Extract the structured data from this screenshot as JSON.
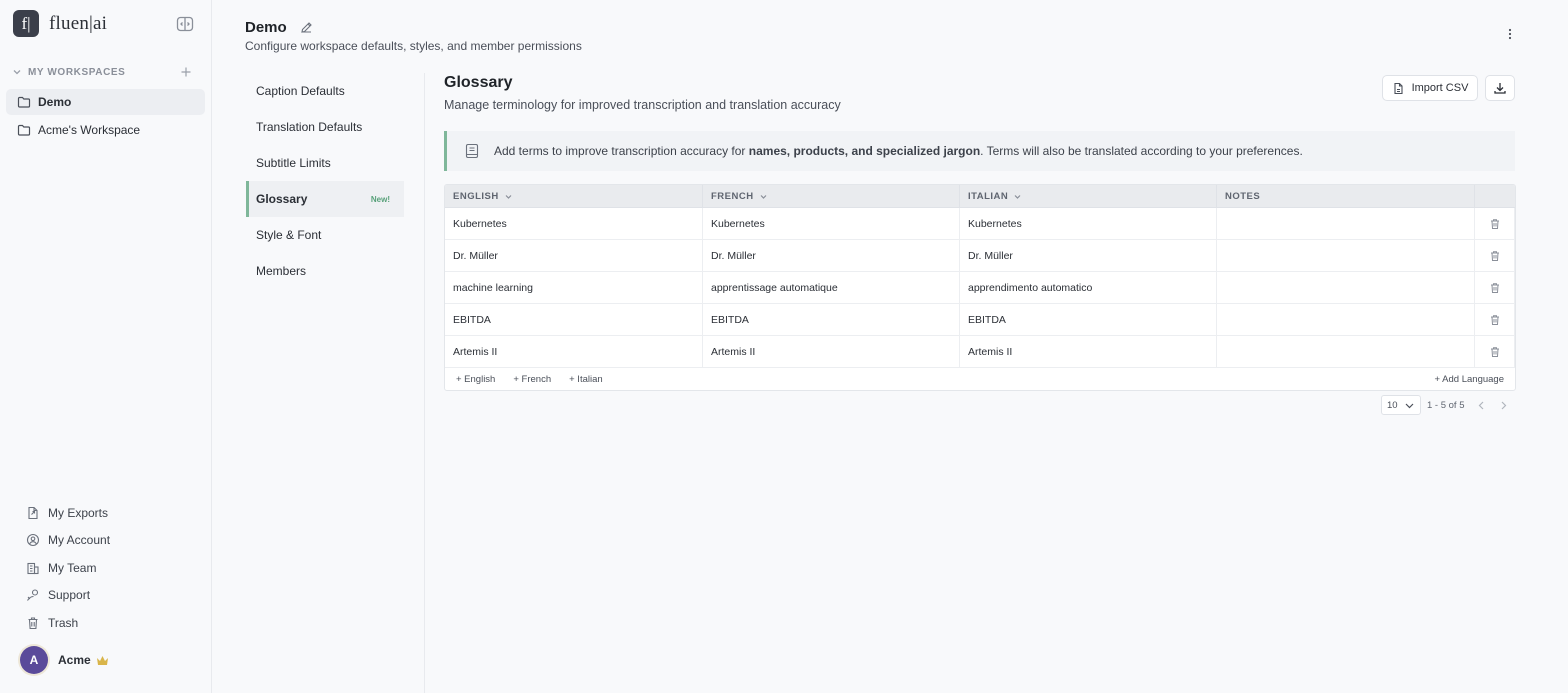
{
  "brand": {
    "logo_letter": "f|",
    "name": "fluen|ai"
  },
  "sidebar": {
    "section_label": "MY WORKSPACES",
    "workspaces": [
      {
        "label": "Demo",
        "active": true
      },
      {
        "label": "Acme's Workspace",
        "active": false
      }
    ],
    "bottom_links": [
      {
        "label": "My Exports",
        "icon": "exports-icon"
      },
      {
        "label": "My Account",
        "icon": "account-icon"
      },
      {
        "label": "My Team",
        "icon": "team-icon"
      },
      {
        "label": "Support",
        "icon": "support-icon"
      },
      {
        "label": "Trash",
        "icon": "trash-icon"
      }
    ],
    "user": {
      "initial": "A",
      "name": "Acme",
      "badge_icon": "crown-icon"
    }
  },
  "header": {
    "title": "Demo",
    "subtitle": "Configure workspace defaults, styles, and member permissions"
  },
  "settings_menu": {
    "items": [
      {
        "label": "Caption Defaults",
        "active": false,
        "badge": ""
      },
      {
        "label": "Translation Defaults",
        "active": false,
        "badge": ""
      },
      {
        "label": "Subtitle Limits",
        "active": false,
        "badge": ""
      },
      {
        "label": "Glossary",
        "active": true,
        "badge": "New!"
      },
      {
        "label": "Style & Font",
        "active": false,
        "badge": ""
      },
      {
        "label": "Members",
        "active": false,
        "badge": ""
      }
    ]
  },
  "glossary": {
    "title": "Glossary",
    "subtitle": "Manage terminology for improved transcription and translation accuracy",
    "import_label": "Import CSV",
    "info": {
      "prefix": "Add terms to improve transcription accuracy for ",
      "bold": "names, products, and specialized jargon",
      "suffix": ". Terms will also be translated according to your preferences."
    },
    "columns": [
      "ENGLISH",
      "FRENCH",
      "ITALIAN",
      "NOTES"
    ],
    "rows": [
      [
        "Kubernetes",
        "Kubernetes",
        "Kubernetes",
        ""
      ],
      [
        "Dr. Müller",
        "Dr. Müller",
        "Dr. Müller",
        ""
      ],
      [
        "machine learning",
        "apprentissage automatique",
        "apprendimento automatico",
        ""
      ],
      [
        "EBITDA",
        "EBITDA",
        "EBITDA",
        ""
      ],
      [
        "Artemis II",
        "Artemis II",
        "Artemis II",
        ""
      ]
    ],
    "add_term_links": [
      "+ English",
      "+ French",
      "+ Italian"
    ],
    "add_language_label": "+ Add Language"
  },
  "pagination": {
    "page_size": "10",
    "range_text": "1 - 5 of 5"
  },
  "colors": {
    "accent": "#7fb79a",
    "badge_new": "#58a17a",
    "avatar": "#5a4a9a",
    "crown": "#d9b54a"
  }
}
